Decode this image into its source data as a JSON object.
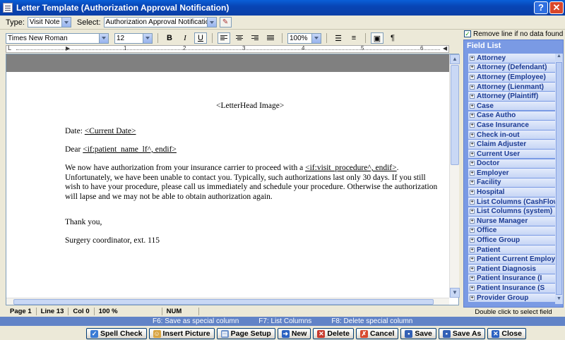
{
  "window": {
    "title": "Letter Template (Authorization Approval Notification)",
    "help": "?",
    "close": "✕"
  },
  "typebar": {
    "type_label": "Type:",
    "type_value": "Visit Note",
    "select_label": "Select:",
    "select_value": "Authorization Approval Notification"
  },
  "format": {
    "font": "Times New Roman",
    "size": "12",
    "bold": "B",
    "italic": "I",
    "underline": "U",
    "zoom": "100%",
    "para_mark": "¶"
  },
  "ruler": {
    "marks": [
      "1",
      "2",
      "3",
      "4",
      "5",
      "6"
    ]
  },
  "letter": {
    "letterhead": "<LetterHead Image>",
    "date_label": "Date: ",
    "date_field": "<Current Date>",
    "dear_label": "Dear ",
    "dear_field": "<if:patient_name_lf^, endif>",
    "body_1": "We now have authorization from your insurance carrier to proceed with a ",
    "body_field": "<if:visit_procedure^, endif>",
    "body_2": ". Unfortunately, we have been unable to contact you. Typically, such authorizations last only 30 days. If you still wish to have your procedure, please call us immediately and schedule your procedure. Otherwise the authorization will lapse and we may not be able to obtain authorization again.",
    "closing": "Thank you,",
    "signature": "Surgery coordinator, ext. 115"
  },
  "status": {
    "page": "Page   1",
    "line": "Line  13",
    "col": "Col   0",
    "zoom": "100 %",
    "num": "NUM"
  },
  "keys": {
    "f6": "F6: Save as special column",
    "f7": "F7: List Columns",
    "f8": "F8: Delete special column"
  },
  "buttons": {
    "spell": "Spell Check",
    "insert_picture": "Insert Picture",
    "page_setup": "Page Setup",
    "new": "New",
    "delete": "Delete",
    "cancel": "Cancel",
    "save": "Save",
    "save_as": "Save As",
    "close": "Close"
  },
  "fieldpanel": {
    "remove_line": "Remove line if no data found",
    "title": "Field List",
    "hint": "Double click to select field",
    "items": [
      "Attorney",
      "Attorney (Defendant)",
      "Attorney (Employee)",
      "Attorney (Lienmant)",
      "Attorney (Plaintiff)",
      "Case",
      "Case Autho",
      "Case Insurance",
      "Check in-out",
      "Claim Adjuster",
      "Current User",
      "Doctor",
      "Employer",
      "Facility",
      "Hospital",
      "List Columns (CashFlow)",
      "List Columns (system)",
      "Nurse Manager",
      "Office",
      "Office Group",
      "Patient",
      "Patient Current Employer",
      "Patient Diagnosis",
      "Patient Insurance (I",
      "Patient Insurance (S",
      "Provider Group"
    ]
  }
}
